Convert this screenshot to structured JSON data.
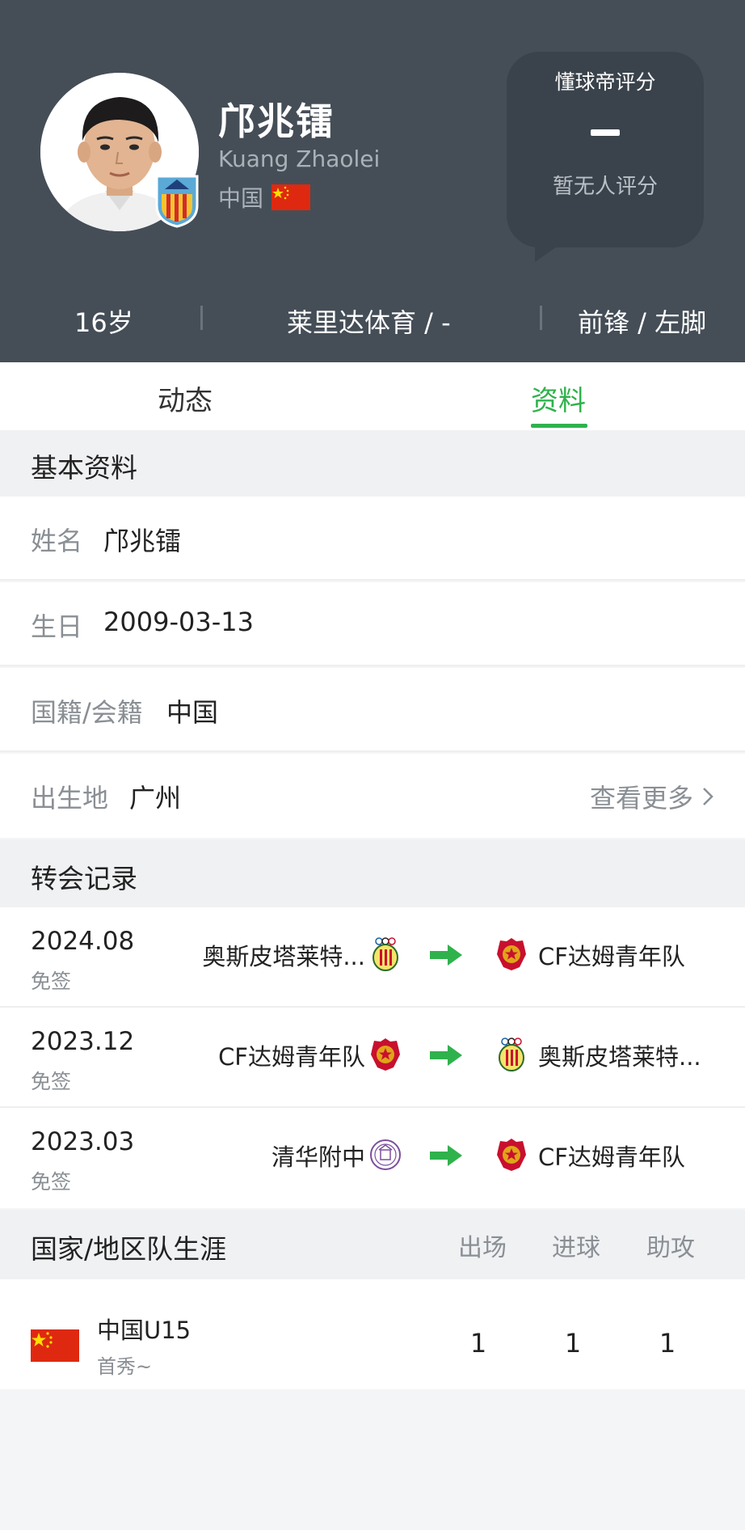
{
  "header": {
    "name": "邝兆镭",
    "name_en": "Kuang Zhaolei",
    "nationality": "中国",
    "rating": {
      "title": "懂球帝评分",
      "value": "-",
      "subtitle": "暂无人评分"
    },
    "stats": {
      "age": "16岁",
      "club": "莱里达体育 / -",
      "position": "前锋 / 左脚"
    }
  },
  "tabs": [
    {
      "label": "动态",
      "active": false
    },
    {
      "label": "资料",
      "active": true
    }
  ],
  "basic": {
    "section_title": "基本资料",
    "rows": [
      {
        "label": "姓名",
        "value": "邝兆镭"
      },
      {
        "label": "生日",
        "value": "2009-03-13"
      },
      {
        "label": "国籍/会籍",
        "value": "中国"
      },
      {
        "label": "出生地",
        "value": "广州"
      }
    ],
    "more_label": "查看更多"
  },
  "transfers": {
    "section_title": "转会记录",
    "rows": [
      {
        "date": "2024.08",
        "type": "免签",
        "from": "奥斯皮塔莱特...",
        "to": "CF达姆青年队"
      },
      {
        "date": "2023.12",
        "type": "免签",
        "from": "CF达姆青年队",
        "to": "奥斯皮塔莱特..."
      },
      {
        "date": "2023.03",
        "type": "免签",
        "from": "清华附中",
        "to": "CF达姆青年队"
      }
    ]
  },
  "national": {
    "section_title": "国家/地区队生涯",
    "columns": [
      "出场",
      "进球",
      "助攻"
    ],
    "rows": [
      {
        "team": "中国U15",
        "note": "首秀~",
        "apps": "1",
        "goals": "1",
        "assists": "1"
      }
    ]
  },
  "colors": {
    "header_bg": "#454e57",
    "accent_green": "#2fb24c",
    "flag_red": "#de2910"
  }
}
